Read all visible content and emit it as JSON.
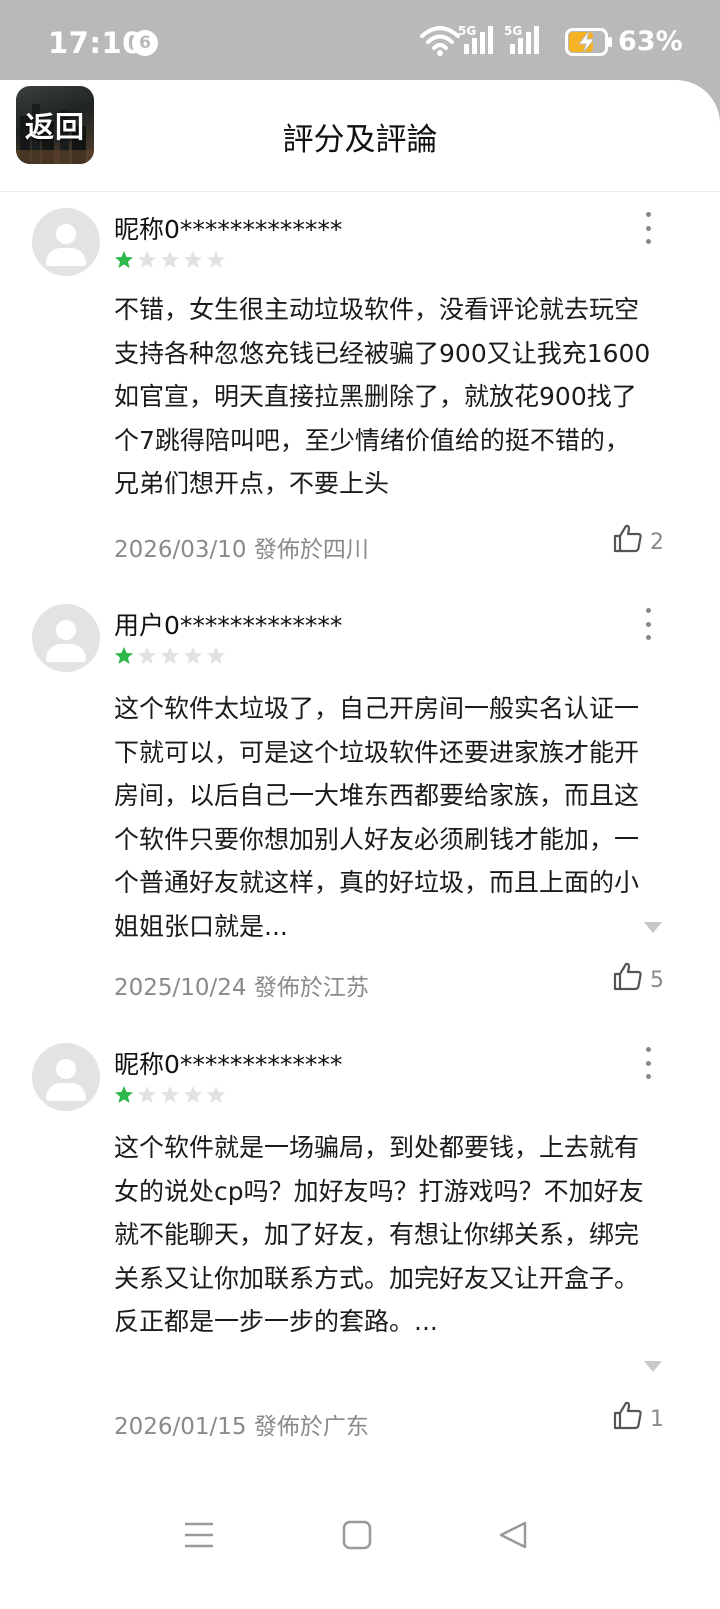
{
  "status_bar": {
    "time": "17:10",
    "notification_count": "6",
    "network_tag_1": "5G",
    "network_tag_2": "5G",
    "battery_percent": "63%",
    "battery_color": "#f5b324"
  },
  "header": {
    "back_label": "返回",
    "title": "評分及評論"
  },
  "reviews": [
    {
      "name": "昵称0*************",
      "rating": 1,
      "text": "不错，女生很主动垃圾软件，没看评论就去玩空支持各种忽悠充钱已经被骗了900又让我充1600如官宣，明天直接拉黑删除了，就放花900找了个7跳得陪叫吧，至少情绪价值给的挺不错的，兄弟们想开点，不要上头",
      "date": "2026/03/10",
      "location": "發佈於四川",
      "likes": "2",
      "truncated": false
    },
    {
      "name": "用户0*************",
      "rating": 1,
      "text": "这个软件太垃圾了，自己开房间一般实名认证一下就可以，可是这个垃圾软件还要进家族才能开房间，以后自己一大堆东西都要给家族，而且这个软件只要你想加别人好友必须刷钱才能加，一个普通好友就这样，真的好垃圾，而且上面的小姐姐张口就是...",
      "date": "2025/10/24",
      "location": "發佈於江苏",
      "likes": "5",
      "truncated": true
    },
    {
      "name": "昵称0*************",
      "rating": 1,
      "text": "这个软件就是一场骗局，到处都要钱，上去就有女的说处cp吗？加好友吗？打游戏吗？不加好友就不能聊天，加了好友，有想让你绑关系，绑完关系又让你加联系方式。加完好友又让开盒子。反正都是一步一步的套路。...",
      "date": "2026/01/15",
      "location": "發佈於广东",
      "likes": "1",
      "truncated": true
    }
  ],
  "colors": {
    "star_filled": "#2db84b",
    "star_empty": "#e2e2e2",
    "status_bar_bg": "#b9b9b9"
  },
  "nav_bar": {
    "icons": [
      "menu-icon",
      "home-square-icon",
      "back-triangle-icon"
    ]
  }
}
